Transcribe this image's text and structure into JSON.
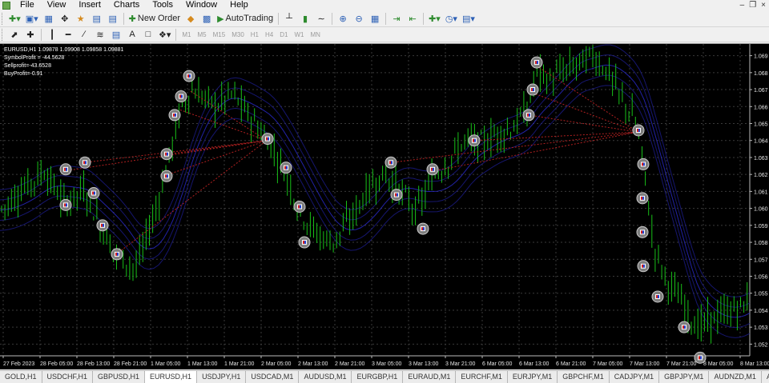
{
  "menubar": {
    "items": [
      "File",
      "View",
      "Insert",
      "Charts",
      "Tools",
      "Window",
      "Help"
    ]
  },
  "toolbar1": {
    "new_order_label": "New Order",
    "autotrading_label": "AutoTrading"
  },
  "toolbar2": {
    "timeframes": [
      "M1",
      "M5",
      "M15",
      "M30",
      "H1",
      "H4",
      "D1",
      "W1",
      "MN"
    ]
  },
  "chart": {
    "info_lines": [
      "EURUSD,H1  1.09878 1.09908 1.09858 1.09881",
      "SymbolProfit = -44.5628",
      "Sellprofit=-43.6528",
      "BuyProfit=-0.91"
    ],
    "background": "#000000",
    "grid_color": "#3a3a3a",
    "candle_color": "#18c018",
    "price_axis_labels": [
      "1.069",
      "1.068",
      "1.067",
      "1.066",
      "1.065",
      "1.064",
      "1.063",
      "1.062",
      "1.061",
      "1.060",
      "1.059",
      "1.058",
      "1.057",
      "1.056",
      "1.055",
      "1.054",
      "1.053",
      "1.052"
    ],
    "time_axis_labels": [
      "27 Feb 2023",
      "28 Feb 05:00",
      "28 Feb 13:00",
      "28 Feb 21:00",
      "1 Mar 05:00",
      "1 Mar 13:00",
      "1 Mar 21:00",
      "2 Mar 05:00",
      "2 Mar 13:00",
      "2 Mar 21:00",
      "3 Mar 05:00",
      "3 Mar 13:00",
      "3 Mar 21:00",
      "6 Mar 05:00",
      "6 Mar 13:00",
      "6 Mar 21:00",
      "7 Mar 05:00",
      "7 Mar 13:00",
      "7 Mar 21:00",
      "8 Mar 05:00",
      "8 Mar 13:00"
    ]
  },
  "tabs": [
    "GOLD,H1",
    "USDCHF,H1",
    "GBPUSD,H1",
    "EURUSD,H1",
    "USDJPY,H1",
    "USDCAD,M1",
    "AUDUSD,M1",
    "EURGBP,H1",
    "EURAUD,M1",
    "EURCHF,M1",
    "EURJPY,M1",
    "GBPCHF,M1",
    "CADJPY,M1",
    "GBPJPY,M1",
    "AUDNZD,M1",
    "AUDC..."
  ],
  "active_tab": "EURUSD,H1"
}
